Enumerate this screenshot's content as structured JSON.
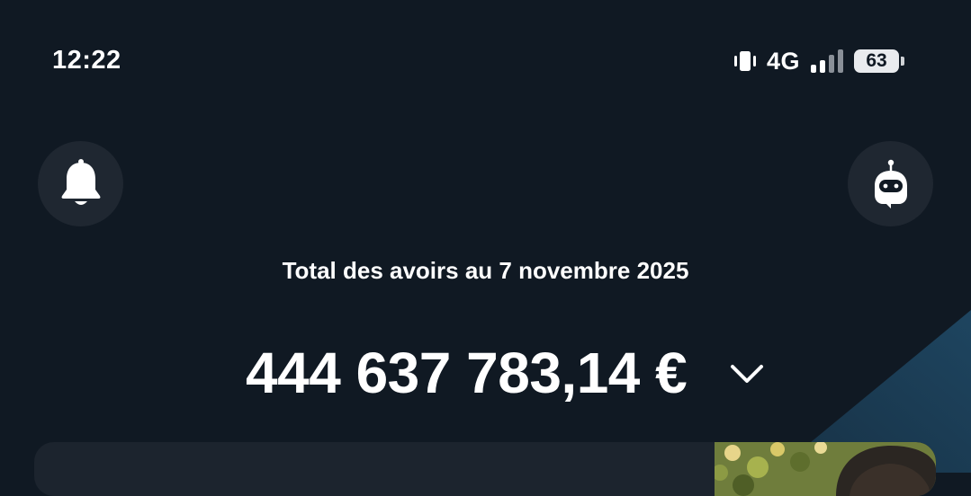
{
  "status_bar": {
    "time": "12:22",
    "network": "4G",
    "battery_level": "63",
    "icons": [
      "vibrate-icon",
      "signal-icon",
      "battery-icon"
    ]
  },
  "header": {
    "left_button_icon": "bell-icon",
    "right_button_icon": "robot-icon"
  },
  "balance": {
    "caption": "Total des avoirs au 7 novembre 2025",
    "amount": "444 637 783,14 €",
    "toggle_icon": "chevron-down-icon"
  },
  "colors": {
    "background": "#101923",
    "button_background": "#1f2731",
    "card_background": "#1c242e",
    "accent_wedge": "#1b3a4e",
    "text": "#ffffff"
  }
}
